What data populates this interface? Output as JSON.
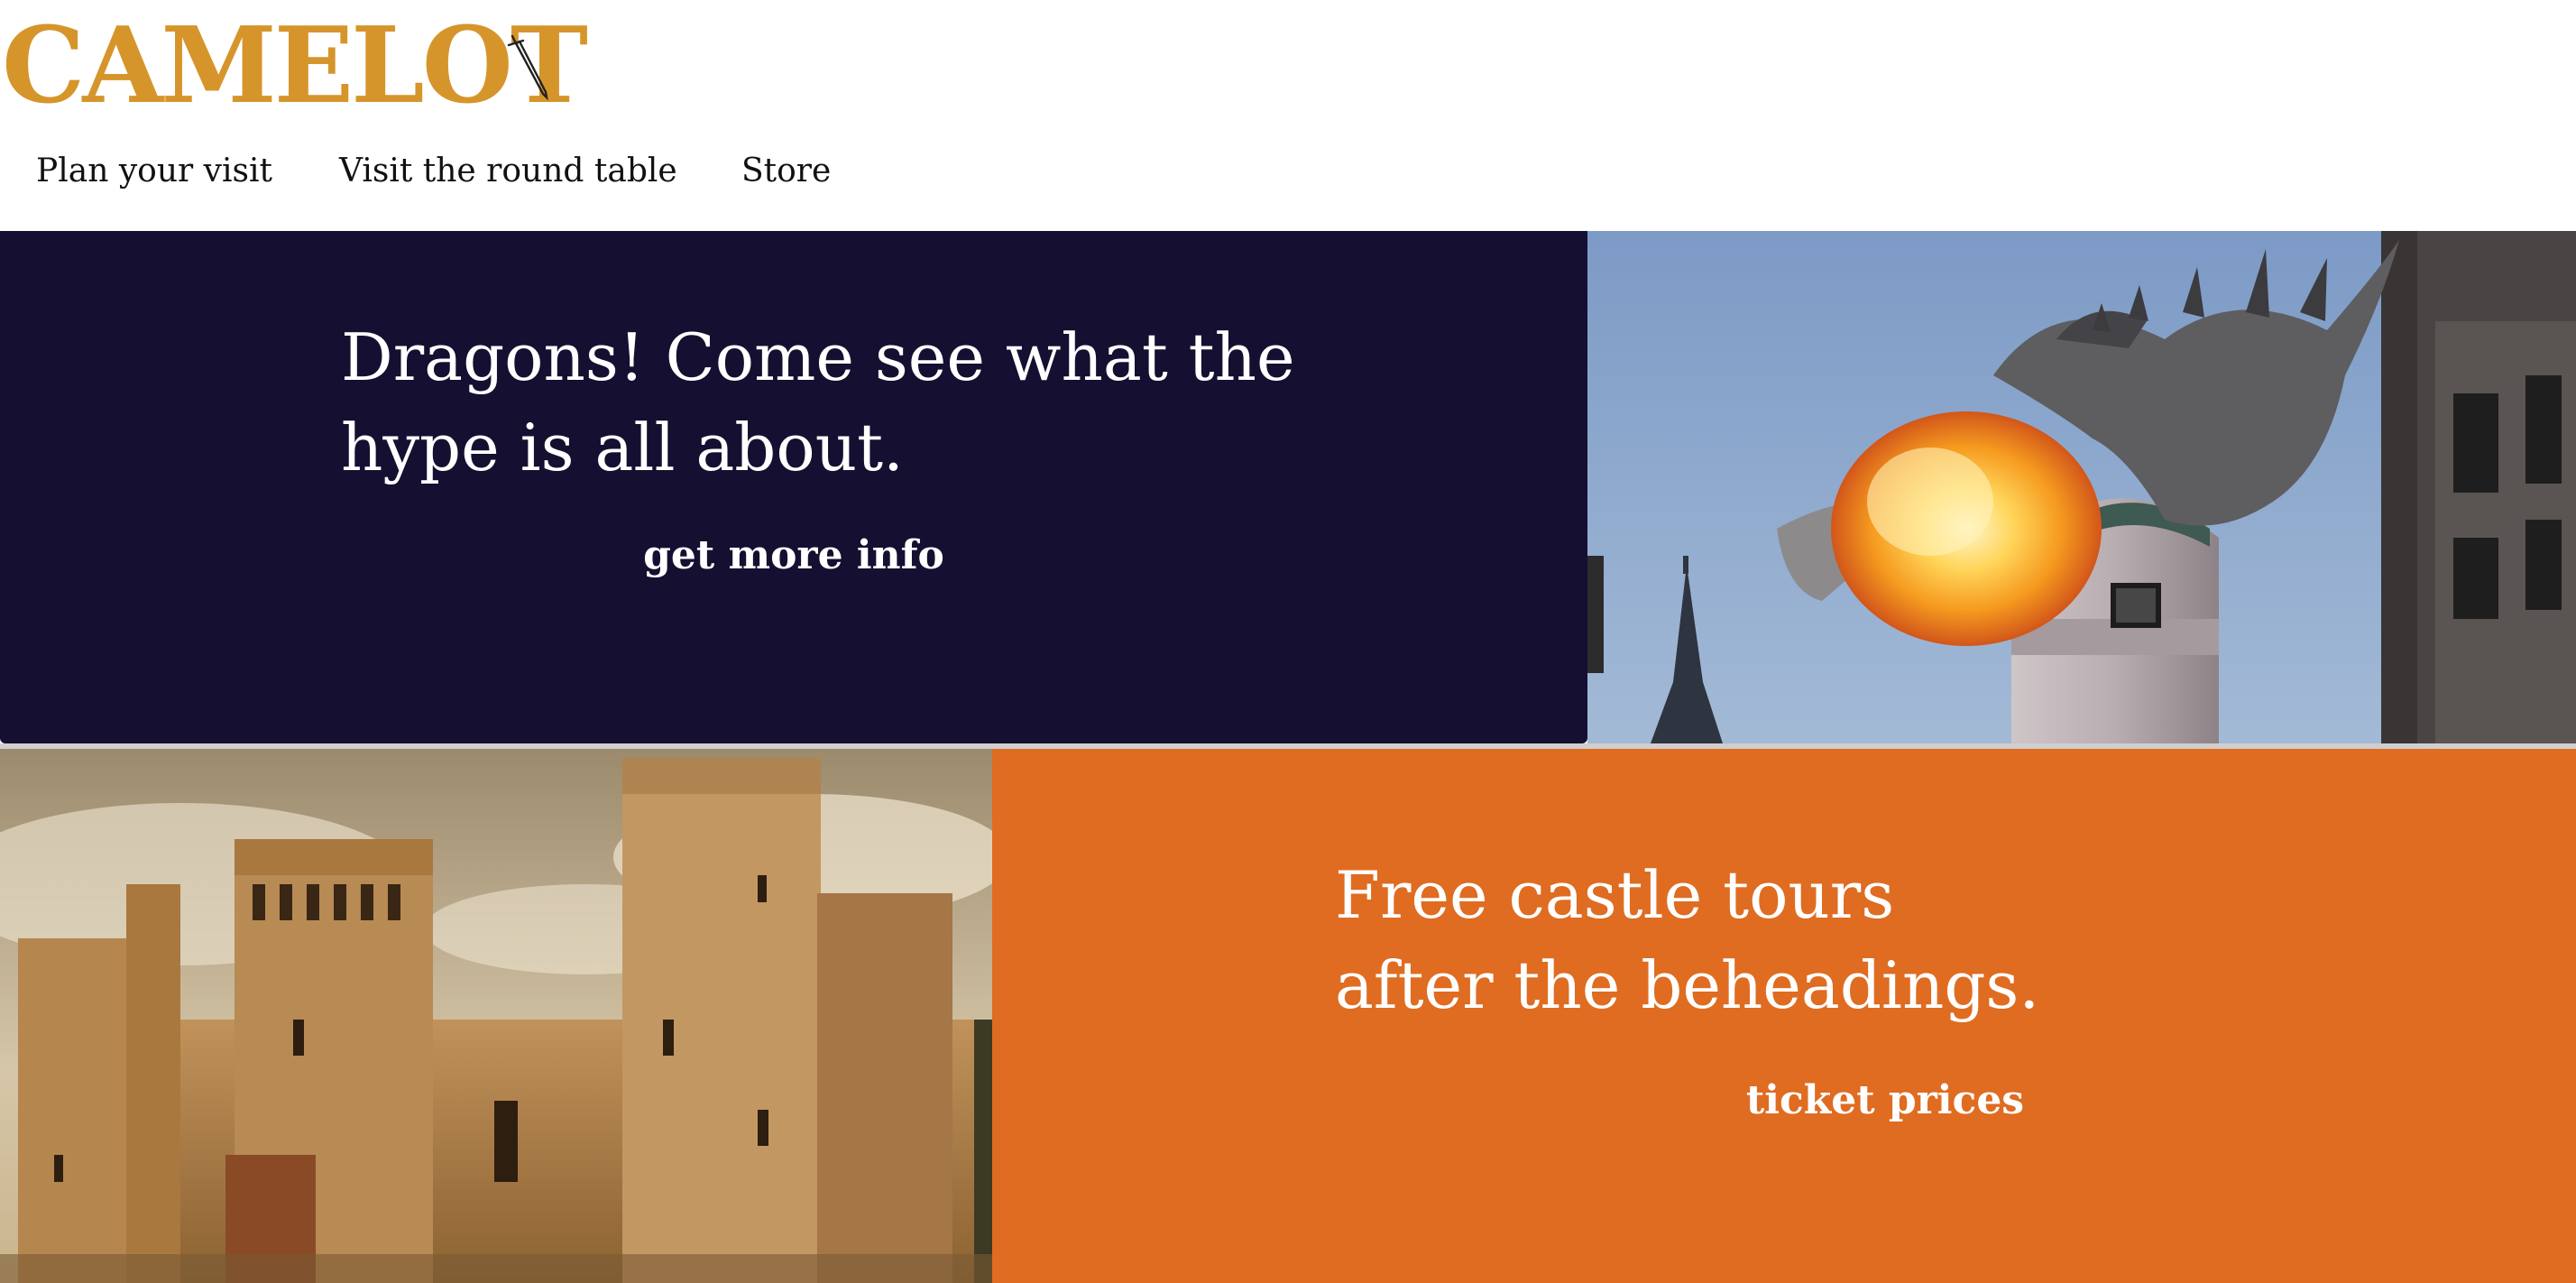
{
  "header": {
    "logo_text": "CAMELOT",
    "logo_icon": "sword-icon",
    "logo_color": "#d6952b",
    "nav": [
      {
        "label": "Plan your visit"
      },
      {
        "label": "Visit the round table"
      },
      {
        "label": "Store"
      }
    ]
  },
  "dragons_panel": {
    "heading_line1": "Dragons! Come see what the",
    "heading_line2": "hype is all about.",
    "link_label": "get more info",
    "background_color": "#150f31"
  },
  "castle_panel": {
    "heading_line1": "Free castle tours",
    "heading_line2": "after the beheadings.",
    "link_label": "ticket prices",
    "background_color": "#df6c21"
  }
}
